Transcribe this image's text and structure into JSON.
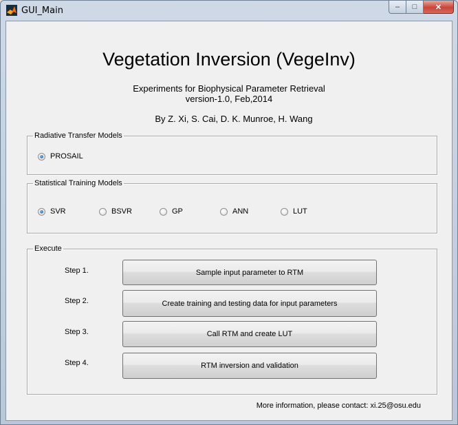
{
  "window": {
    "title": "GUI_Main",
    "caption_buttons": {
      "minimize": "–",
      "maximize": "□",
      "close": "✕"
    }
  },
  "header": {
    "title": "Vegetation Inversion (VegeInv)",
    "subtitle": "Experiments for Biophysical Parameter Retrieval",
    "version": "version-1.0, Feb,2014",
    "authors": "By Z. Xi, S. Cai, D. K. Munroe, H. Wang"
  },
  "rtm_panel": {
    "legend": "Radiative Transfer Models",
    "options": [
      {
        "label": "PROSAIL",
        "checked": true
      }
    ]
  },
  "stm_panel": {
    "legend": "Statistical Training Models",
    "options": [
      {
        "label": "SVR",
        "checked": true
      },
      {
        "label": "BSVR",
        "checked": false
      },
      {
        "label": "GP",
        "checked": false
      },
      {
        "label": "ANN",
        "checked": false
      },
      {
        "label": "LUT",
        "checked": false
      }
    ]
  },
  "execute_panel": {
    "legend": "Execute",
    "steps": [
      {
        "label": "Step 1.",
        "button": "Sample input parameter to RTM"
      },
      {
        "label": "Step 2.",
        "button": "Create training and testing data for input parameters"
      },
      {
        "label": "Step 3.",
        "button": "Call RTM and create LUT"
      },
      {
        "label": "Step 4.",
        "button": "RTM inversion and validation"
      }
    ]
  },
  "footer": {
    "contact": "More information, please contact: xi.25@osu.edu"
  },
  "colors": {
    "accent": "#1d5fa8",
    "close_button": "#c8443a",
    "client_bg": "#f0f0f0"
  },
  "icons": {
    "app": "matlab-icon"
  }
}
